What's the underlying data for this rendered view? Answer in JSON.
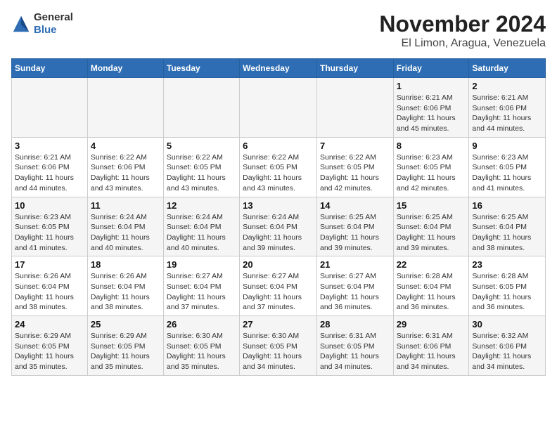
{
  "header": {
    "logo_general": "General",
    "logo_blue": "Blue",
    "title": "November 2024",
    "subtitle": "El Limon, Aragua, Venezuela"
  },
  "days_of_week": [
    "Sunday",
    "Monday",
    "Tuesday",
    "Wednesday",
    "Thursday",
    "Friday",
    "Saturday"
  ],
  "weeks": [
    [
      {
        "day": "",
        "info": ""
      },
      {
        "day": "",
        "info": ""
      },
      {
        "day": "",
        "info": ""
      },
      {
        "day": "",
        "info": ""
      },
      {
        "day": "",
        "info": ""
      },
      {
        "day": "1",
        "info": "Sunrise: 6:21 AM\nSunset: 6:06 PM\nDaylight: 11 hours and 45 minutes."
      },
      {
        "day": "2",
        "info": "Sunrise: 6:21 AM\nSunset: 6:06 PM\nDaylight: 11 hours and 44 minutes."
      }
    ],
    [
      {
        "day": "3",
        "info": "Sunrise: 6:21 AM\nSunset: 6:06 PM\nDaylight: 11 hours and 44 minutes."
      },
      {
        "day": "4",
        "info": "Sunrise: 6:22 AM\nSunset: 6:06 PM\nDaylight: 11 hours and 43 minutes."
      },
      {
        "day": "5",
        "info": "Sunrise: 6:22 AM\nSunset: 6:05 PM\nDaylight: 11 hours and 43 minutes."
      },
      {
        "day": "6",
        "info": "Sunrise: 6:22 AM\nSunset: 6:05 PM\nDaylight: 11 hours and 43 minutes."
      },
      {
        "day": "7",
        "info": "Sunrise: 6:22 AM\nSunset: 6:05 PM\nDaylight: 11 hours and 42 minutes."
      },
      {
        "day": "8",
        "info": "Sunrise: 6:23 AM\nSunset: 6:05 PM\nDaylight: 11 hours and 42 minutes."
      },
      {
        "day": "9",
        "info": "Sunrise: 6:23 AM\nSunset: 6:05 PM\nDaylight: 11 hours and 41 minutes."
      }
    ],
    [
      {
        "day": "10",
        "info": "Sunrise: 6:23 AM\nSunset: 6:05 PM\nDaylight: 11 hours and 41 minutes."
      },
      {
        "day": "11",
        "info": "Sunrise: 6:24 AM\nSunset: 6:04 PM\nDaylight: 11 hours and 40 minutes."
      },
      {
        "day": "12",
        "info": "Sunrise: 6:24 AM\nSunset: 6:04 PM\nDaylight: 11 hours and 40 minutes."
      },
      {
        "day": "13",
        "info": "Sunrise: 6:24 AM\nSunset: 6:04 PM\nDaylight: 11 hours and 39 minutes."
      },
      {
        "day": "14",
        "info": "Sunrise: 6:25 AM\nSunset: 6:04 PM\nDaylight: 11 hours and 39 minutes."
      },
      {
        "day": "15",
        "info": "Sunrise: 6:25 AM\nSunset: 6:04 PM\nDaylight: 11 hours and 39 minutes."
      },
      {
        "day": "16",
        "info": "Sunrise: 6:25 AM\nSunset: 6:04 PM\nDaylight: 11 hours and 38 minutes."
      }
    ],
    [
      {
        "day": "17",
        "info": "Sunrise: 6:26 AM\nSunset: 6:04 PM\nDaylight: 11 hours and 38 minutes."
      },
      {
        "day": "18",
        "info": "Sunrise: 6:26 AM\nSunset: 6:04 PM\nDaylight: 11 hours and 38 minutes."
      },
      {
        "day": "19",
        "info": "Sunrise: 6:27 AM\nSunset: 6:04 PM\nDaylight: 11 hours and 37 minutes."
      },
      {
        "day": "20",
        "info": "Sunrise: 6:27 AM\nSunset: 6:04 PM\nDaylight: 11 hours and 37 minutes."
      },
      {
        "day": "21",
        "info": "Sunrise: 6:27 AM\nSunset: 6:04 PM\nDaylight: 11 hours and 36 minutes."
      },
      {
        "day": "22",
        "info": "Sunrise: 6:28 AM\nSunset: 6:04 PM\nDaylight: 11 hours and 36 minutes."
      },
      {
        "day": "23",
        "info": "Sunrise: 6:28 AM\nSunset: 6:05 PM\nDaylight: 11 hours and 36 minutes."
      }
    ],
    [
      {
        "day": "24",
        "info": "Sunrise: 6:29 AM\nSunset: 6:05 PM\nDaylight: 11 hours and 35 minutes."
      },
      {
        "day": "25",
        "info": "Sunrise: 6:29 AM\nSunset: 6:05 PM\nDaylight: 11 hours and 35 minutes."
      },
      {
        "day": "26",
        "info": "Sunrise: 6:30 AM\nSunset: 6:05 PM\nDaylight: 11 hours and 35 minutes."
      },
      {
        "day": "27",
        "info": "Sunrise: 6:30 AM\nSunset: 6:05 PM\nDaylight: 11 hours and 34 minutes."
      },
      {
        "day": "28",
        "info": "Sunrise: 6:31 AM\nSunset: 6:05 PM\nDaylight: 11 hours and 34 minutes."
      },
      {
        "day": "29",
        "info": "Sunrise: 6:31 AM\nSunset: 6:06 PM\nDaylight: 11 hours and 34 minutes."
      },
      {
        "day": "30",
        "info": "Sunrise: 6:32 AM\nSunset: 6:06 PM\nDaylight: 11 hours and 34 minutes."
      }
    ]
  ]
}
